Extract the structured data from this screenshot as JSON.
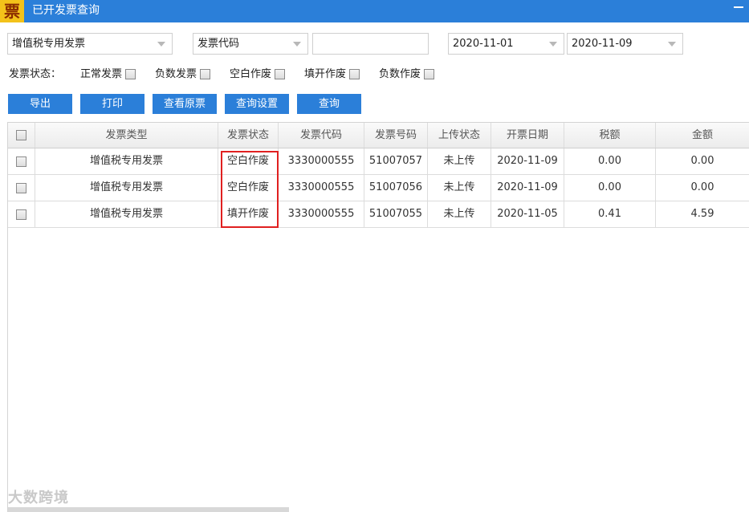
{
  "window": {
    "logo_char": "票",
    "title": "已开发票查询"
  },
  "filters": {
    "invoice_type_selected": "增值税专用发票",
    "field_selected": "发票代码",
    "search_value": "",
    "date_start": "2020-11-01",
    "date_end": "2020-11-09"
  },
  "status_filter": {
    "label": "发票状态：",
    "options": [
      "正常发票",
      "负数发票",
      "空白作废",
      "填开作废",
      "负数作废"
    ]
  },
  "toolbar": {
    "export_label": "导出",
    "print_label": "打印",
    "view_original_label": "查看原票",
    "query_settings_label": "查询设置",
    "query_label": "查询"
  },
  "table": {
    "columns": [
      "发票类型",
      "发票状态",
      "发票代码",
      "发票号码",
      "上传状态",
      "开票日期",
      "税额",
      "金额"
    ],
    "rows": [
      [
        "增值税专用发票",
        "空白作废",
        "3330000555",
        "51007057",
        "未上传",
        "2020-11-09",
        "0.00",
        "0.00"
      ],
      [
        "增值税专用发票",
        "空白作废",
        "3330000555",
        "51007056",
        "未上传",
        "2020-11-09",
        "0.00",
        "0.00"
      ],
      [
        "增值税专用发票",
        "填开作废",
        "3330000555",
        "51007055",
        "未上传",
        "2020-11-05",
        "0.41",
        "4.59"
      ]
    ]
  },
  "watermark": "大数跨境",
  "colors": {
    "titlebar": "#2b7fd9",
    "button": "#2b7fd9",
    "highlight_box": "#e02020"
  }
}
